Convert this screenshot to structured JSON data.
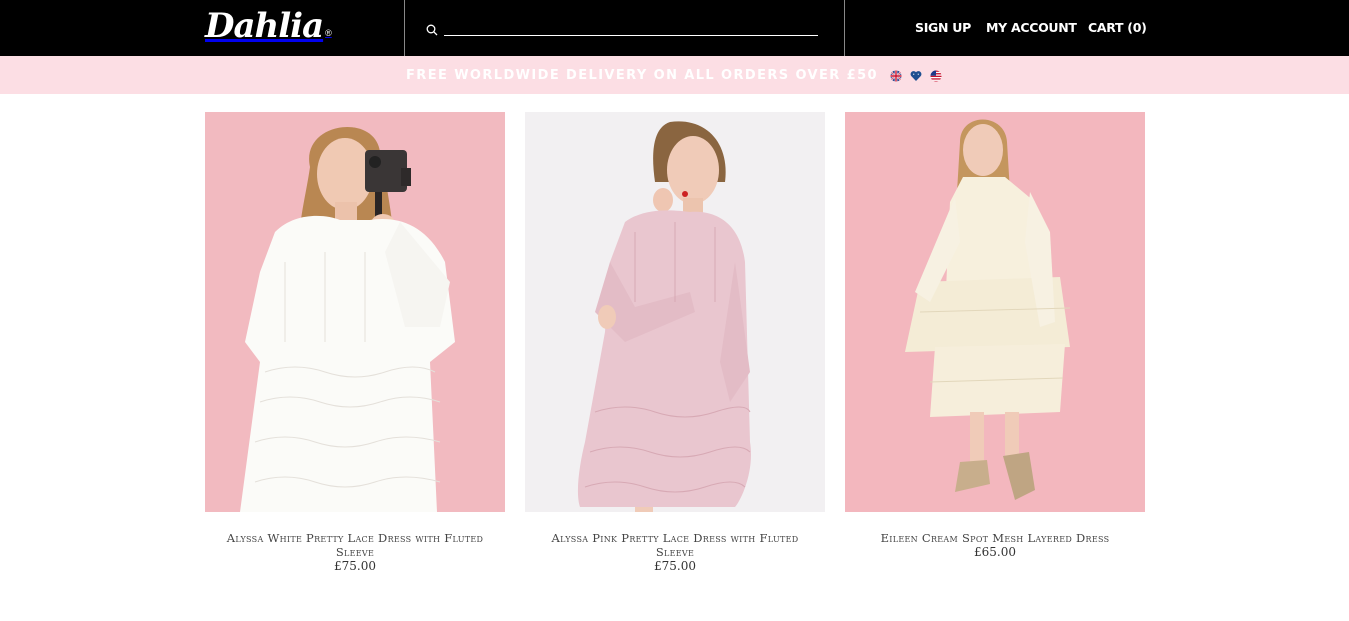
{
  "header": {
    "logo": "Dahlia",
    "logo_mark": "®",
    "search": {
      "placeholder": "",
      "value": "",
      "icon": "search-icon"
    },
    "nav": {
      "signup": "SIGN UP",
      "account": "MY ACCOUNT",
      "cart": "CART (0)"
    }
  },
  "banner": {
    "text": "FREE WORLDWIDE DELIVERY ON ALL ORDERS OVER £50",
    "icons": [
      "uk-flag-icon",
      "heart-icon",
      "us-flag-icon"
    ]
  },
  "products": [
    {
      "name": "Alyssa White Pretty Lace Dress with Fluted Sleeve",
      "price": "£75.00",
      "background": "#f1b4bb",
      "dress_color": "#fbfbf8"
    },
    {
      "name": "Alyssa Pink Pretty Lace Dress with Fluted Sleeve",
      "price": "£75.00",
      "background": "#f2f0f2",
      "dress_color": "#e9c6cf"
    },
    {
      "name": "Eileen Cream Spot Mesh Layered Dress",
      "price": "£65.00",
      "background": "#f3b7be",
      "dress_color": "#f7f0dd"
    }
  ],
  "colors": {
    "header_bg": "#000000",
    "banner_bg": "#fcdee4",
    "banner_text": "#ffffff"
  }
}
